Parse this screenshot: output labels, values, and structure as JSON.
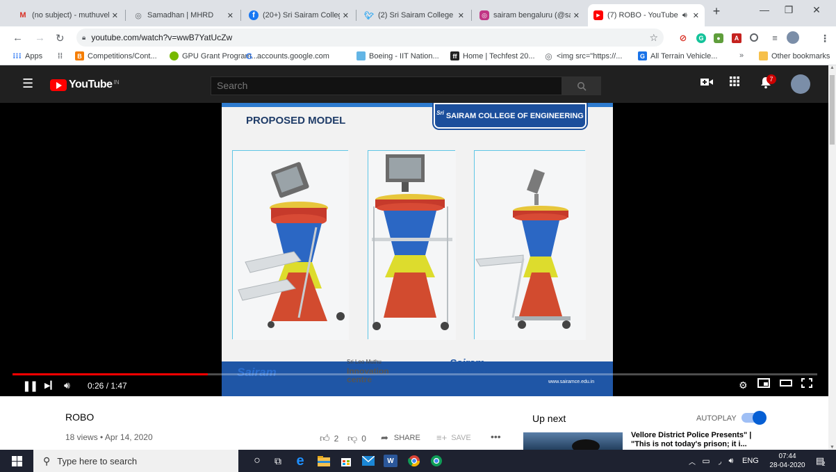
{
  "tabs": [
    {
      "label": "(no subject) - muthuvel",
      "icon": "gmail-icon",
      "color": "#d93025",
      "glyph": "M"
    },
    {
      "label": "Samadhan | MHRD",
      "icon": "globe-icon",
      "color": "#5f6368",
      "glyph": "◎"
    },
    {
      "label": "(20+) Sri Sairam College",
      "icon": "facebook-icon",
      "color": "#1877f2",
      "glyph": "f"
    },
    {
      "label": "(2) Sri Sairam College o",
      "icon": "twitter-icon",
      "color": "#1da1f2",
      "glyph": "♥"
    },
    {
      "label": "sairam bengaluru (@sai",
      "icon": "instagram-icon",
      "color": "#c13584",
      "glyph": "◉"
    },
    {
      "label": "(7) ROBO - YouTube",
      "icon": "youtube-icon",
      "color": "#ff0000",
      "glyph": "▶"
    }
  ],
  "address": {
    "url": "youtube.com/watch?v=wwB7YatUcZw"
  },
  "bookmarks": [
    {
      "label": "Apps",
      "icon": "apps-grid-icon",
      "color": "#4285f4"
    },
    {
      "label": "",
      "icon": "dots-grid-icon",
      "color": "#5f6368"
    },
    {
      "label": "Competitions/Cont...",
      "icon": "blogger-icon",
      "color": "#f57d00"
    },
    {
      "label": "GPU Grant Program...",
      "icon": "nvidia-icon",
      "color": "#76b900"
    },
    {
      "label": "accounts.google.com",
      "icon": "google-icon",
      "color": "#4285f4"
    },
    {
      "label": "Boeing - IIT Nation...",
      "icon": "boeing-icon",
      "color": "#63b5e5"
    },
    {
      "label": "Home | Techfest 20...",
      "icon": "techfest-icon",
      "color": "#222222"
    },
    {
      "label": "<img src=\"https://...",
      "icon": "globe-icon",
      "color": "#5f6368"
    },
    {
      "label": "All Terrain Vehicle...",
      "icon": "site-icon",
      "color": "#1a73e8"
    },
    {
      "label": "Other bookmarks",
      "icon": "folder-icon",
      "color": "#f6c04b"
    }
  ],
  "youtube": {
    "logo": "YouTube",
    "country": "IN",
    "search_placeholder": "Search",
    "notification_count": "7"
  },
  "slide": {
    "title": "PROPOSED MODEL",
    "badge": "SAIRAM COLLEGE OF ENGINEERING",
    "badge_prefix": "Sri",
    "footer_left": "Sairam",
    "footer_mid_top": "Sri Leo Muthu",
    "footer_mid": "Innovation centre",
    "footer_right": "Sairam",
    "footer_right_sub": "BUSINESS INCUBATOR",
    "website": "www.sairamce.edu.in"
  },
  "player": {
    "time": "0:26 / 1:47",
    "progress": 0.243
  },
  "video": {
    "title": "ROBO",
    "meta": "18 views • Apr 14, 2020",
    "likes": "2",
    "dislikes": "0",
    "share": "SHARE",
    "save": "SAVE",
    "up_next": "Up next",
    "autoplay": "AUTOPLAY",
    "next_title": "Vellore District Police Presents\" | \"This is not today's prison; it i..."
  },
  "taskbar": {
    "search_placeholder": "Type here to search",
    "lang": "ENG",
    "time": "07:44",
    "date": "28-04-2020",
    "notif": "2"
  }
}
